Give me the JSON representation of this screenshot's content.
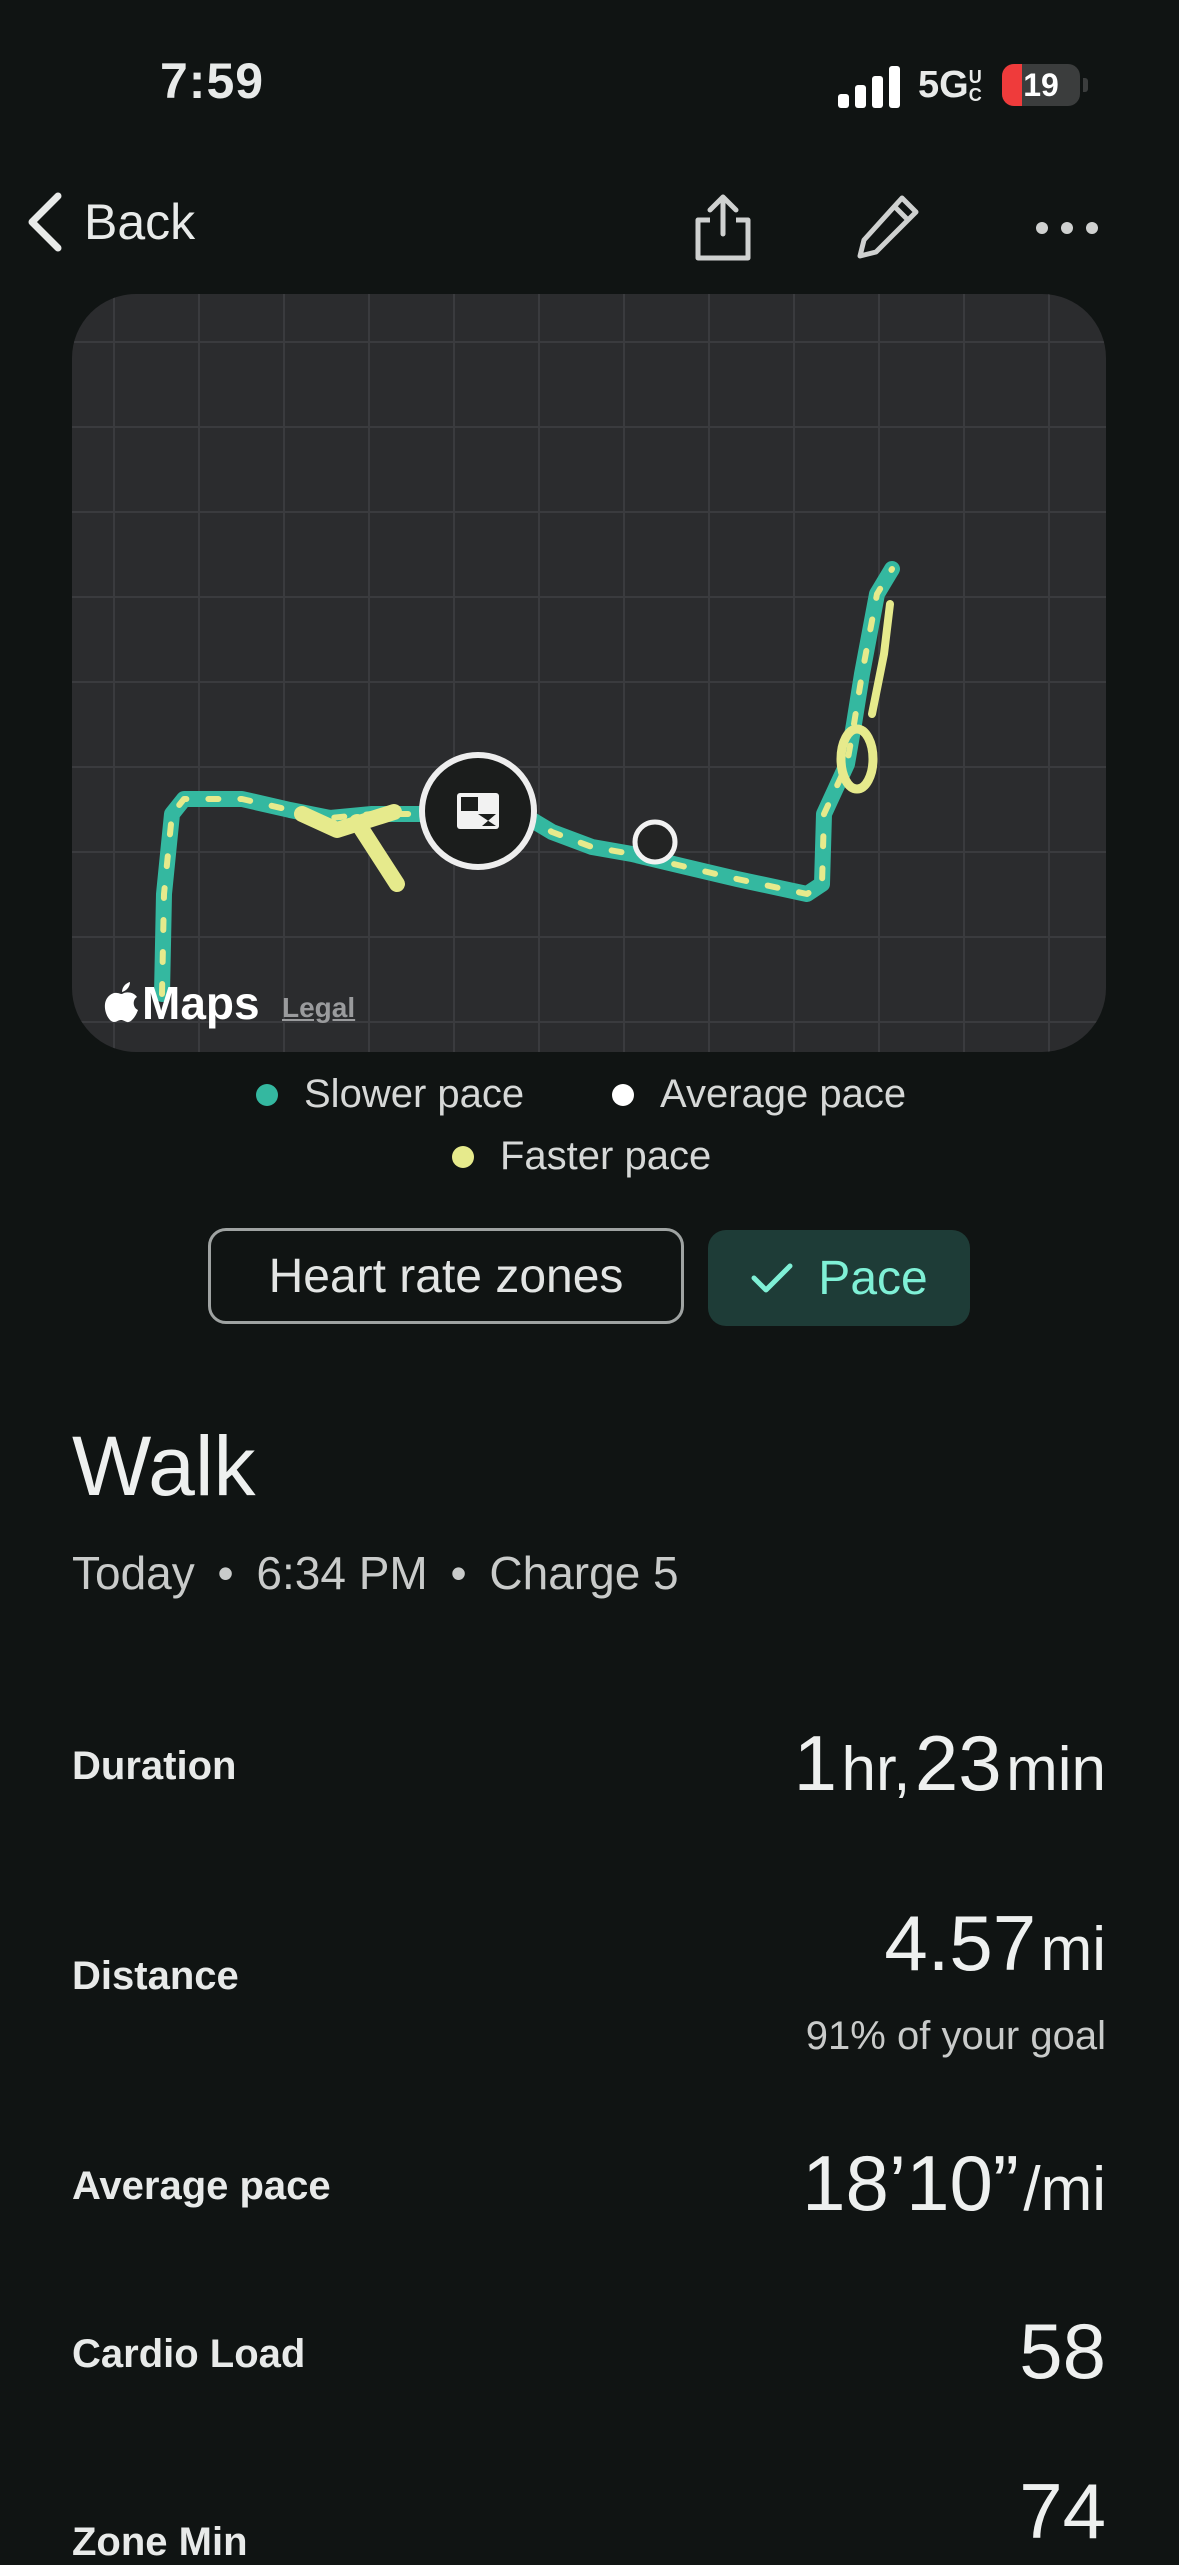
{
  "status_bar": {
    "time": "7:59",
    "network": "5G",
    "network_suffix": "UC",
    "battery": "19"
  },
  "nav": {
    "back_label": "Back"
  },
  "map": {
    "logo_text": "Maps",
    "legal_text": "Legal"
  },
  "legend": {
    "slower": "Slower pace",
    "average": "Average pace",
    "faster": "Faster pace",
    "colors": {
      "slower": "#34b8a0",
      "average": "#ffffff",
      "faster": "#e6ea8c"
    }
  },
  "toggles": {
    "heart_rate": "Heart rate zones",
    "pace": "Pace",
    "selected": "Pace"
  },
  "activity": {
    "title": "Walk",
    "date": "Today",
    "time": "6:34 PM",
    "device": "Charge 5"
  },
  "stats": {
    "duration": {
      "label": "Duration",
      "hours": "1",
      "hours_unit": "hr,",
      "minutes": "23",
      "minutes_unit": "min"
    },
    "distance": {
      "label": "Distance",
      "value": "4.57",
      "unit": "mi",
      "goal_note": "91% of your goal"
    },
    "average_pace": {
      "label": "Average pace",
      "value": "18’10”",
      "unit": "/mi"
    },
    "cardio_load": {
      "label": "Cardio Load",
      "value": "58"
    },
    "zone_min": {
      "label": "Zone Min",
      "value": "74"
    }
  }
}
